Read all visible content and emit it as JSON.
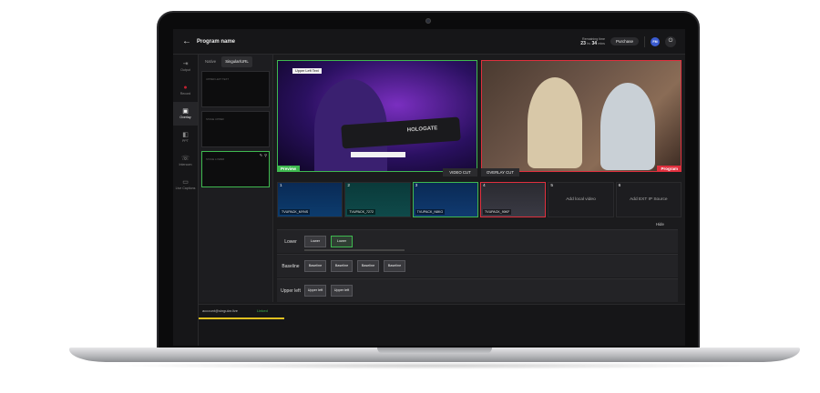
{
  "header": {
    "back_icon": "arrow-left-icon",
    "program_name": "Program name",
    "remaining_label": "Remaining time",
    "remaining_hours": "23",
    "remaining_hours_unit": "hs",
    "remaining_mins": "34",
    "remaining_mins_unit": "mins",
    "purchase_label": "Purchase",
    "avatar_initials": "FM"
  },
  "nav": {
    "items": [
      {
        "label": "Output",
        "icon": "output-icon"
      },
      {
        "label": "Record",
        "icon": "record-icon"
      },
      {
        "label": "Overlay",
        "icon": "overlay-icon"
      },
      {
        "label": "PPT",
        "icon": "ppt-icon"
      },
      {
        "label": "Intercom",
        "icon": "phone-icon"
      },
      {
        "label": "Live Captions",
        "icon": "captions-icon"
      }
    ]
  },
  "overlay_panel": {
    "tabs": [
      "Native",
      "Singular/URL"
    ],
    "thumbs": [
      "UPPER LEFT TEXT",
      "STAGE UPPER",
      "STAGE LOWER"
    ]
  },
  "preview": {
    "tag": "Preview",
    "upper_left_text": "Upper Left Text",
    "gun_text": "HOLOGATE"
  },
  "program": {
    "tag": "Program"
  },
  "cuts": {
    "video_cut": "VIDEO CUT",
    "overlay_cut": "OVERLAY CUT"
  },
  "sources": [
    {
      "num": "1",
      "name": "TVUPACK_MYNS"
    },
    {
      "num": "2",
      "name": "TVUPACK_7272"
    },
    {
      "num": "3",
      "name": "TVUPACK_N8KG"
    },
    {
      "num": "4",
      "name": "TVUPACK_90KF"
    },
    {
      "num": "5",
      "add": "Add local video"
    },
    {
      "num": "6",
      "add": "Add EXT IP Source"
    }
  ],
  "hide_label": "Hide",
  "rows": {
    "lower": {
      "label": "Lower",
      "chips": [
        "Lower",
        "Lower"
      ]
    },
    "baseline": {
      "label": "Baseline",
      "chips": [
        "Baseline",
        "Baseline",
        "Baseline",
        "Baseline"
      ]
    },
    "upper_left": {
      "label": "Upper left",
      "chips": [
        "Upper left",
        "Upper left"
      ]
    }
  },
  "bottom": {
    "account": "account@singular.live",
    "status": "Linked"
  },
  "colors": {
    "green": "#3fb950",
    "red": "#e0303e",
    "accent": "#3a5bd0"
  }
}
